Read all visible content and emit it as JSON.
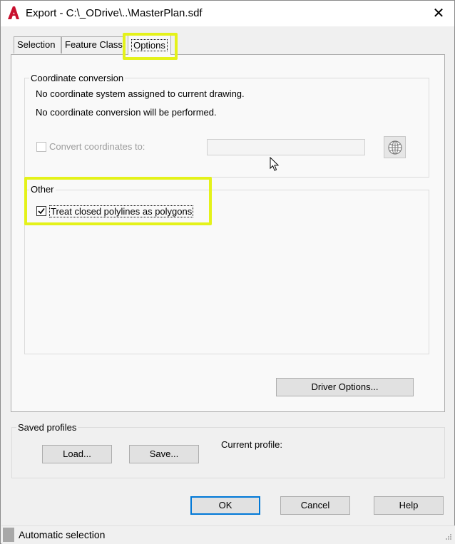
{
  "window": {
    "title": "Export - C:\\_ODrive\\..\\MasterPlan.sdf",
    "close_glyph": "✕",
    "app_icon_letter": "A"
  },
  "tabs": [
    {
      "label": "Selection"
    },
    {
      "label": "Feature Class"
    },
    {
      "label": "Options",
      "active": true
    }
  ],
  "coordinate_conversion": {
    "group_label": "Coordinate conversion",
    "line1": "No coordinate system assigned to current drawing.",
    "line2": "No coordinate conversion will be performed.",
    "convert_label": "Convert coordinates to:",
    "convert_value": ""
  },
  "other": {
    "group_label": "Other",
    "polygons_label": "Treat closed polylines as polygons",
    "polygons_checked": true
  },
  "driver_options_label": "Driver Options...",
  "saved_profiles": {
    "group_label": "Saved profiles",
    "load_label": "Load...",
    "save_label": "Save...",
    "current_profile_label": "Current profile:"
  },
  "footer": {
    "ok_label": "OK",
    "cancel_label": "Cancel",
    "help_label": "Help"
  },
  "status": {
    "text": "Automatic selection"
  },
  "colors": {
    "highlight": "#e4f21a",
    "accent": "#0078d7",
    "app_red": "#c8102e"
  }
}
